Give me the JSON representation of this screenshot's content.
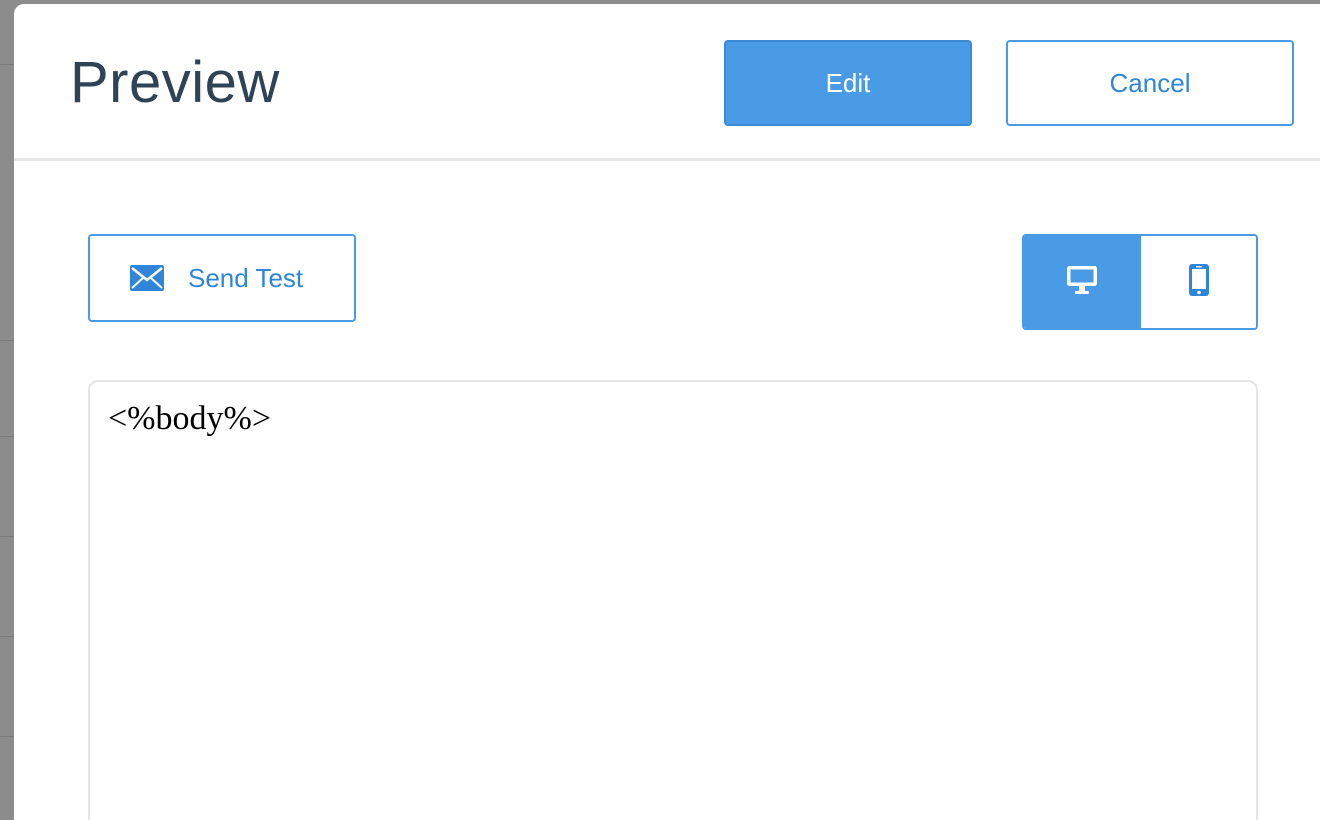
{
  "modal": {
    "title": "Preview",
    "edit_label": "Edit",
    "cancel_label": "Cancel"
  },
  "toolbar": {
    "send_test_label": "Send Test",
    "send_test_icon": "envelope-icon",
    "device_options": [
      {
        "icon": "desktop-icon",
        "selected": true
      },
      {
        "icon": "mobile-icon",
        "selected": false
      }
    ]
  },
  "preview": {
    "body_text": "<%body%>"
  },
  "colors": {
    "accent": "#4a9be6",
    "accent_text": "#2f86d8",
    "title_text": "#2f4356"
  }
}
